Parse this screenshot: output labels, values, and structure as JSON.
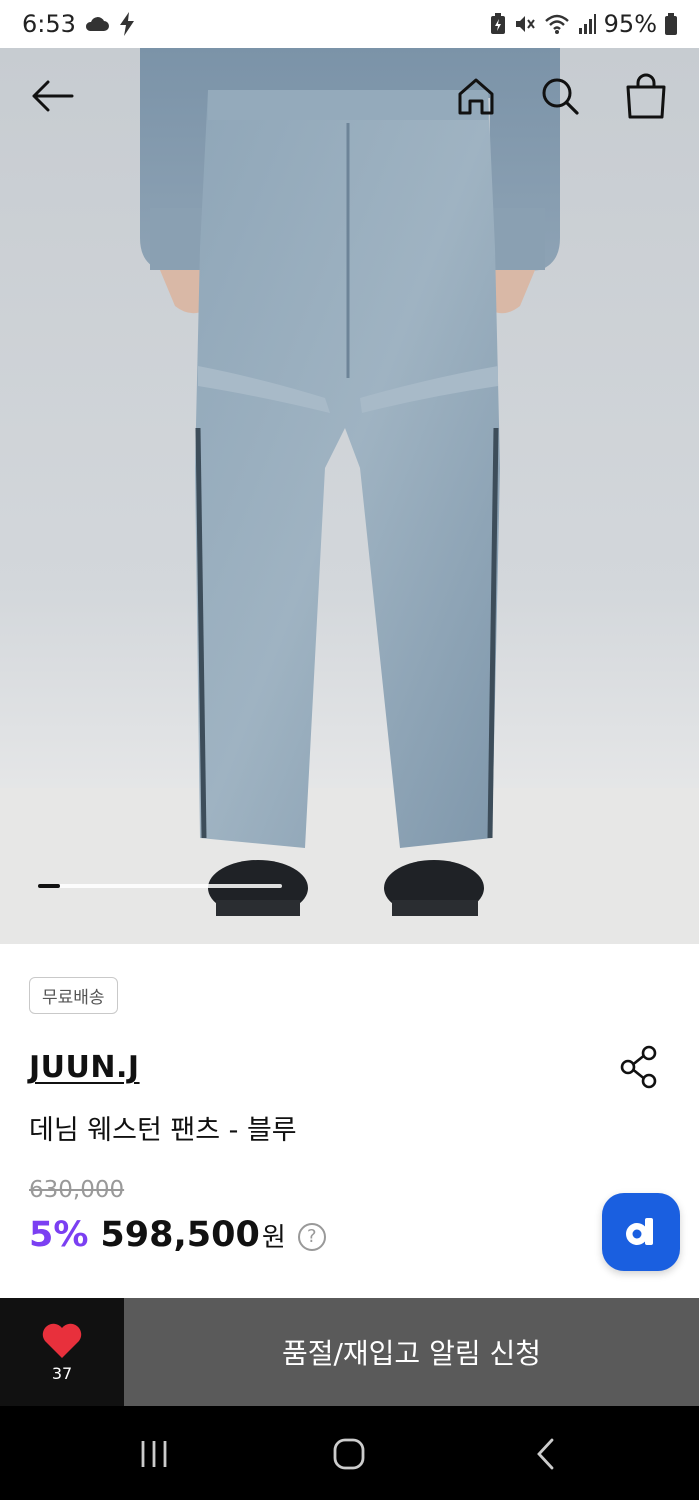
{
  "status_bar": {
    "time": "6:53",
    "battery": "95%",
    "icons": [
      "cloud-icon",
      "bolt-icon",
      "battery-saver-icon",
      "mute-icon",
      "wifi-icon",
      "signal-icon",
      "battery-icon"
    ]
  },
  "top_nav": {
    "icons": [
      "back-arrow-icon",
      "home-icon",
      "search-icon",
      "shopping-bag-icon"
    ]
  },
  "gallery": {
    "image_icon": "denim-pants-photo",
    "progress": 0.09
  },
  "product": {
    "badge": "무료배송",
    "brand": "JUUN.J",
    "name": "데님 웨스턴 팬츠 - 블루",
    "original_price": "630,000",
    "discount": "5%",
    "price": "598,500",
    "currency": "원",
    "help_symbol": "?"
  },
  "floating_button": {
    "label": "d",
    "color": "#1a5fe0"
  },
  "bottom_bar": {
    "like_count": "37",
    "restock_label": "품절/재입고 알림 신청"
  },
  "colors": {
    "accent_discount": "#7b3ff2",
    "heart": "#e8303c",
    "cta_bg": "#5a5a5a"
  }
}
